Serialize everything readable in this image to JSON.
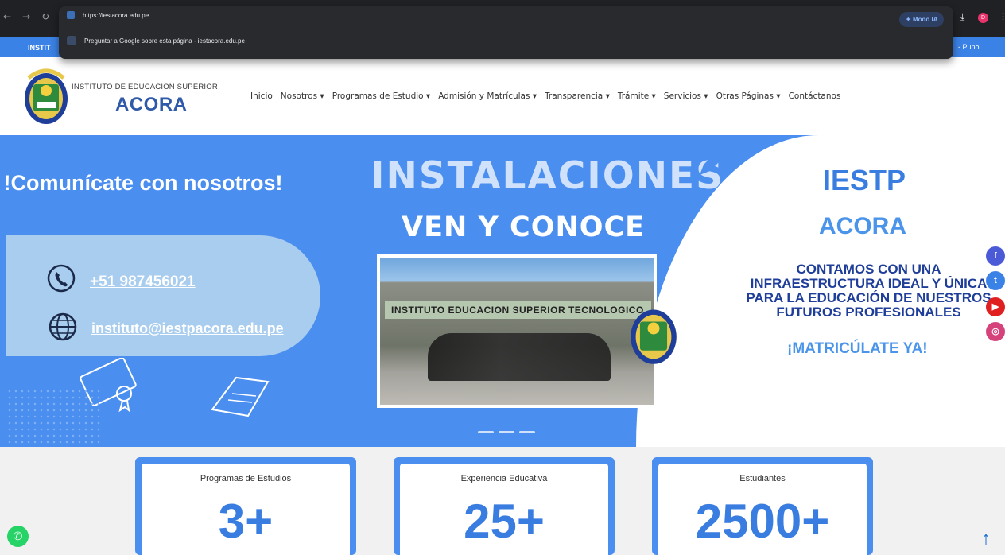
{
  "browser": {
    "url": "https://iestacora.edu.pe",
    "suggestion": "Preguntar a Google sobre esta página - iestacora.edu.pe",
    "modo_ia": "Modo IA",
    "avatar_letter": "D"
  },
  "topstrip": {
    "left_text": "INSTIT",
    "right_text": "- Puno"
  },
  "brand": {
    "top": "INSTITUTO DE EDUCACION SUPERIOR",
    "name": "ACORA"
  },
  "menu": [
    "Inicio",
    "Nosotros ▾",
    "Programas de Estudio ▾",
    "Admisión y Matrículas ▾",
    "Transparencia ▾",
    "Trámite ▾",
    "Servicios ▾",
    "Otras Páginas ▾",
    "Contáctanos"
  ],
  "hero": {
    "communicate_title": "!Comunícate con nosotros!",
    "phone": "+51 987456021",
    "email": "instituto@iestpacora.edu.pe",
    "installations": "INSTALACIONES",
    "ven_conoce": "VEN Y CONOCE",
    "photo_banner": "INSTITUTO EDUCACION SUPERIOR TECNOLOGICO",
    "iestp": "IESTP",
    "acora": "ACORA",
    "contamos": "CONTAMOS CON UNA INFRAESTRUCTURA IDEAL Y ÚNICA PARA LA EDUCACIÓN DE NUESTROS FUTUROS PROFESIONALES",
    "matriculate": "¡MATRICÚLATE YA!"
  },
  "stats": [
    {
      "label": "Programas de Estudios",
      "value": "3+"
    },
    {
      "label": "Experiencia Educativa",
      "value": "25+"
    },
    {
      "label": "Estudiantes",
      "value": "2500+"
    }
  ],
  "social_icons": [
    "facebook-icon",
    "twitter-icon",
    "youtube-icon",
    "instagram-icon"
  ],
  "colors": {
    "primary": "#4a8ef0",
    "dark_blue": "#1f3e99",
    "accent": "#3a7de0"
  }
}
